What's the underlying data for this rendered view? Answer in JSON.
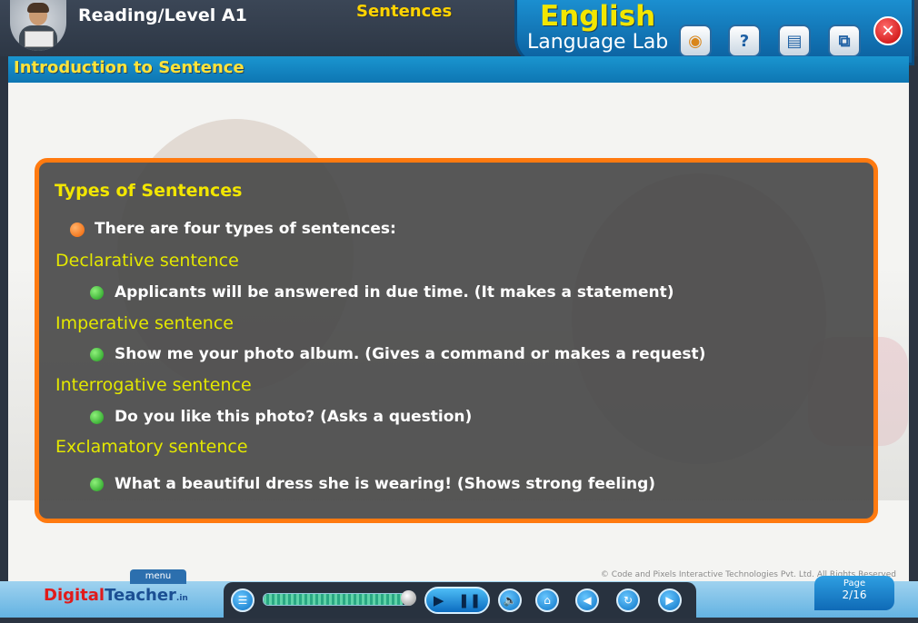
{
  "header": {
    "level_title": "Reading/Level A1",
    "section_title": "Sentences",
    "brand_line1": "English",
    "brand_line2": "Language Lab",
    "toolbar_icons": [
      "score-icon",
      "help-icon",
      "book-icon",
      "window-icon",
      "close-icon"
    ]
  },
  "strip": {
    "title": "Introduction to Sentence"
  },
  "card": {
    "title": "Types of Sentences",
    "intro": "There are four types of sentences:",
    "types": [
      {
        "name": "Declarative sentence",
        "example": "Applicants will be answered in due time. (It makes a statement)"
      },
      {
        "name": "Imperative sentence",
        "example": "Show me your photo album. (Gives a command or makes a request)"
      },
      {
        "name": "Interrogative sentence",
        "example": "Do you like this photo? (Asks a question)"
      },
      {
        "name": "Exclamatory sentence",
        "example": "What a beautiful dress she is wearing! (Shows strong feeling)"
      }
    ]
  },
  "footer": {
    "logo_digital": "Digital",
    "logo_teacher": "Teacher",
    "logo_suffix": ".in",
    "menu_label": "menu",
    "copyright": "© Code and Pixels Interactive Technologies  Pvt. Ltd. All Rights Reserved",
    "progress_fraction": 0.93,
    "page_label": "Page",
    "page_value": "2/16"
  },
  "colors": {
    "accent_orange": "#ff7a10",
    "title_yellow": "#f2e600",
    "bar_blue": "#1a95cf"
  }
}
